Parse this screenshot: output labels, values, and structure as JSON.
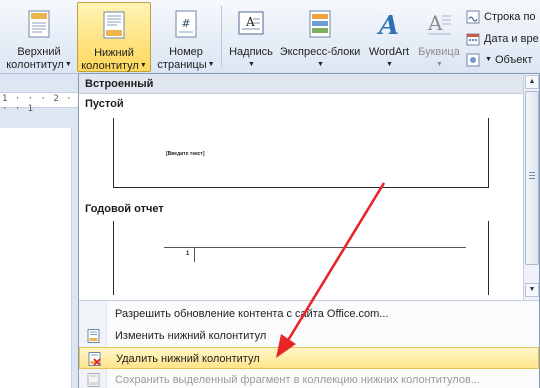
{
  "ribbon": {
    "header_button": {
      "line1": "Верхний",
      "line2": "колонтитул"
    },
    "footer_button": {
      "line1": "Нижний",
      "line2": "колонтитул"
    },
    "page_number_button": {
      "line1": "Номер",
      "line2": "страницы"
    },
    "textbox_button": {
      "label": "Надпись"
    },
    "quickparts_button": {
      "label": "Экспресс-блоки"
    },
    "wordart_button": {
      "label": "WordArt"
    },
    "dropcap_button": {
      "label": "Буквица"
    },
    "signature_line": {
      "label": "Строка по"
    },
    "date_time": {
      "label": "Дата и вре"
    },
    "object": {
      "label": "Объект"
    }
  },
  "ruler": {
    "marks": "1 · · · 2 · · · 1"
  },
  "gallery": {
    "header": "Встроенный",
    "section_blank": {
      "title": "Пустой",
      "placeholder": "[Введите текст]"
    },
    "section_annual": {
      "title": "Годовой отчет",
      "page_number": "1"
    }
  },
  "menu": {
    "items": [
      {
        "label": "Разрешить обновление контента с сайта Office.com..."
      },
      {
        "label": "Изменить нижний колонтитул"
      },
      {
        "label": "Удалить нижний колонтитул"
      },
      {
        "label": "Сохранить выделенный фрагмент в коллекцию нижних колонтитулов..."
      }
    ]
  },
  "colors": {
    "highlight": "#ffe58a",
    "arrow": "#e8262a",
    "ribbon": "#dbe5f3"
  }
}
